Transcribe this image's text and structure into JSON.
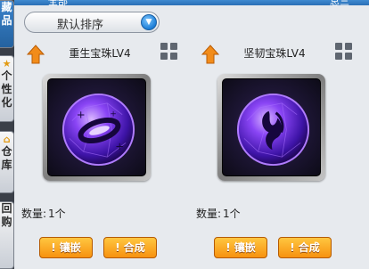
{
  "topbar": {
    "left_text": "全部",
    "right_text": "总三"
  },
  "side_tabs": [
    {
      "icon": "",
      "label": "藏品"
    },
    {
      "icon": "trophy-icon",
      "label": "个性化"
    },
    {
      "icon": "house-icon",
      "label": "仓库"
    },
    {
      "icon": "",
      "label": "回购"
    }
  ],
  "sort": {
    "label": "默认排序"
  },
  "items": [
    {
      "name": "重生宝珠LV4",
      "quantity_label": "数量:",
      "quantity_value": "1个",
      "inlay_label": "镶嵌",
      "combine_label": "合成"
    },
    {
      "name": "坚韧宝珠LV4",
      "quantity_label": "数量:",
      "quantity_value": "1个",
      "inlay_label": "镶嵌",
      "combine_label": "合成"
    }
  ],
  "colors": {
    "button": "#f7920f",
    "orb": "#7b3cf0",
    "tab_active": "#2f77c2"
  }
}
